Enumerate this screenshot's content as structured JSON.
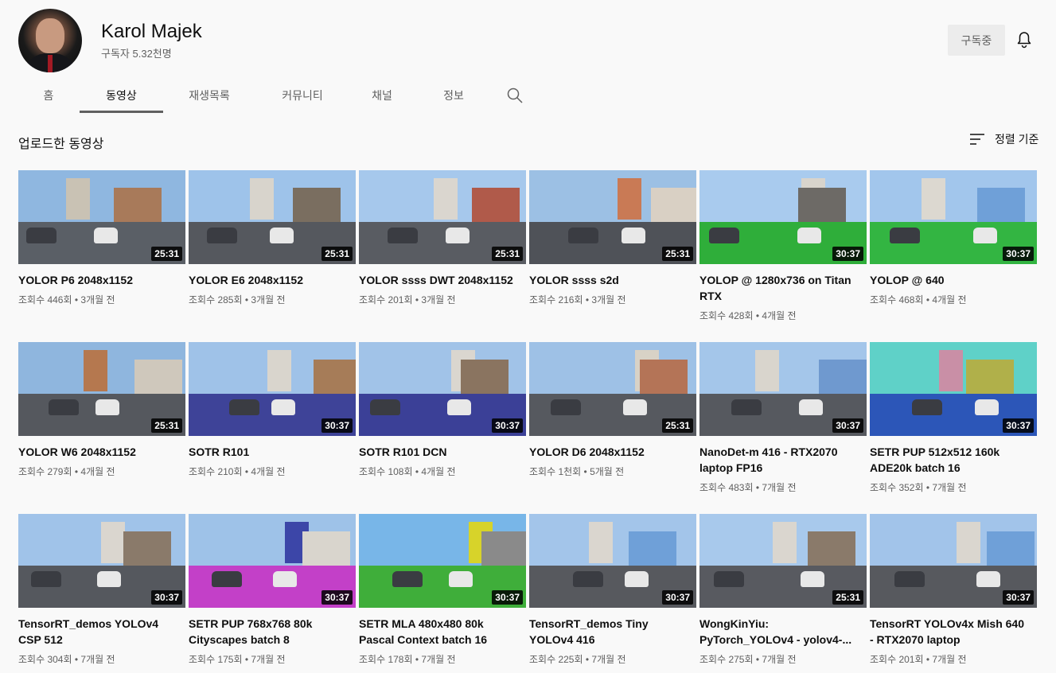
{
  "channel": {
    "name": "Karol Majek",
    "subscribers": "구독자 5.32천명",
    "subscribe_label": "구독중"
  },
  "tabs": [
    {
      "label": "홈",
      "active": false
    },
    {
      "label": "동영상",
      "active": true
    },
    {
      "label": "재생목록",
      "active": false
    },
    {
      "label": "커뮤니티",
      "active": false
    },
    {
      "label": "채널",
      "active": false
    },
    {
      "label": "정보",
      "active": false
    }
  ],
  "section": {
    "title": "업로드한 동영상",
    "sort_label": "정렬 기준"
  },
  "icons": {
    "bell": "bell-icon",
    "search": "search-icon",
    "sort": "sort-icon"
  },
  "videos": [
    {
      "title": "YOLOR P6 2048x1152",
      "views": "조회수 446회",
      "age": "3개월 전",
      "duration": "25:31"
    },
    {
      "title": "YOLOR E6 2048x1152",
      "views": "조회수 285회",
      "age": "3개월 전",
      "duration": "25:31"
    },
    {
      "title": "YOLOR ssss DWT 2048x1152",
      "views": "조회수 201회",
      "age": "3개월 전",
      "duration": "25:31"
    },
    {
      "title": "YOLOR ssss s2d",
      "views": "조회수 216회",
      "age": "3개월 전",
      "duration": "25:31"
    },
    {
      "title": "YOLOP @ 1280x736 on Titan RTX",
      "views": "조회수 428회",
      "age": "4개월 전",
      "duration": "30:37"
    },
    {
      "title": "YOLOP @ 640",
      "views": "조회수 468회",
      "age": "4개월 전",
      "duration": "30:37"
    },
    {
      "title": "YOLOR W6 2048x1152",
      "views": "조회수 279회",
      "age": "4개월 전",
      "duration": "25:31"
    },
    {
      "title": "SOTR R101",
      "views": "조회수 210회",
      "age": "4개월 전",
      "duration": "30:37"
    },
    {
      "title": "SOTR R101 DCN",
      "views": "조회수 108회",
      "age": "4개월 전",
      "duration": "30:37"
    },
    {
      "title": "YOLOR D6 2048x1152",
      "views": "조회수 1천회",
      "age": "5개월 전",
      "duration": "25:31"
    },
    {
      "title": "NanoDet-m 416 - RTX2070 laptop FP16",
      "views": "조회수 483회",
      "age": "7개월 전",
      "duration": "30:37"
    },
    {
      "title": "SETR PUP 512x512 160k ADE20k batch 16",
      "views": "조회수 352회",
      "age": "7개월 전",
      "duration": "30:37"
    },
    {
      "title": "TensorRT_demos YOLOv4 CSP 512",
      "views": "조회수 304회",
      "age": "7개월 전",
      "duration": "30:37"
    },
    {
      "title": "SETR PUP 768x768 80k Cityscapes batch 8",
      "views": "조회수 175회",
      "age": "7개월 전",
      "duration": "30:37"
    },
    {
      "title": "SETR MLA 480x480 80k Pascal Context batch 16",
      "views": "조회수 178회",
      "age": "7개월 전",
      "duration": "30:37"
    },
    {
      "title": "TensorRT_demos Tiny YOLOv4 416",
      "views": "조회수 225회",
      "age": "7개월 전",
      "duration": "30:37"
    },
    {
      "title": "WongKinYiu: PyTorch_YOLOv4 - yolov4-...",
      "views": "조회수 275회",
      "age": "7개월 전",
      "duration": "25:31"
    },
    {
      "title": "TensorRT YOLOv4x Mish 640 - RTX2070 laptop",
      "views": "조회수 201회",
      "age": "7개월 전",
      "duration": "30:37"
    }
  ]
}
